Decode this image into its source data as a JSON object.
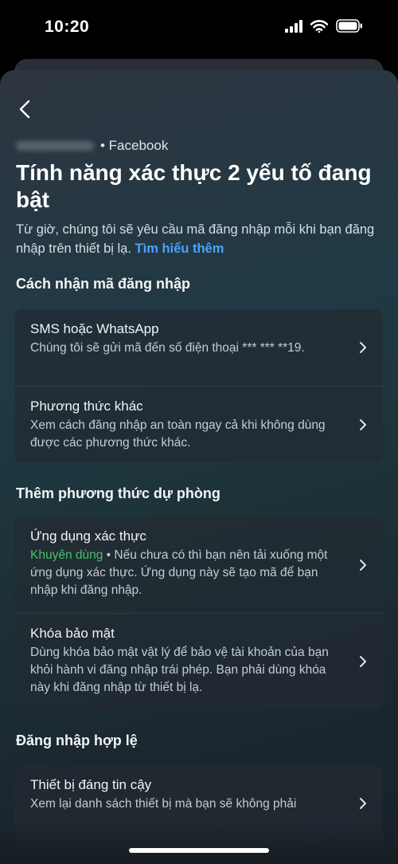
{
  "status_bar": {
    "time": "10:20"
  },
  "header": {
    "account_source": "• Facebook",
    "title": "Tính năng xác thực 2 yếu tố đang bật",
    "intro": "Từ giờ, chúng tôi sẽ yêu cầu mã đăng nhập mỗi khi bạn đăng nhập trên thiết bị lạ.",
    "learn_more": "Tìm hiểu thêm"
  },
  "sections": {
    "receive_code": {
      "heading": "Cách nhận mã đăng nhập",
      "items": [
        {
          "title": "SMS hoặc WhatsApp",
          "desc": "Chúng tôi sẽ gửi mã đến số điện thoại *** *** **19."
        },
        {
          "title": "Phương thức khác",
          "desc": "Xem cách đăng nhập an toàn ngay cả khi không dùng được các phương thức khác."
        }
      ]
    },
    "backup": {
      "heading": "Thêm phương thức dự phòng",
      "items": [
        {
          "title": "Ứng dụng xác thực",
          "badge": "Khuyên dùng",
          "desc": " • Nếu chưa có thì bạn nên tải xuống một ứng dụng xác thực. Ứng dụng này sẽ tạo mã để bạn nhập khi đăng nhập."
        },
        {
          "title": "Khóa bảo mật",
          "desc": "Dùng khóa bảo mật vật lý để bảo vệ tài khoản của bạn khỏi hành vi đăng nhập trái phép. Bạn phải dùng khóa này khi đăng nhập từ thiết bị lạ."
        }
      ]
    },
    "valid_login": {
      "heading": "Đăng nhập hợp lệ",
      "items": [
        {
          "title": "Thiết bị đáng tin cậy",
          "desc": "Xem lại danh sách thiết bị mà bạn sẽ không phải"
        }
      ]
    }
  },
  "colors": {
    "accent_link": "#4aa3ff",
    "recommended_green": "#44c26b"
  },
  "icons": [
    "back-arrow-icon",
    "chevron-right-icon",
    "signal-icon",
    "wifi-icon",
    "battery-icon"
  ]
}
